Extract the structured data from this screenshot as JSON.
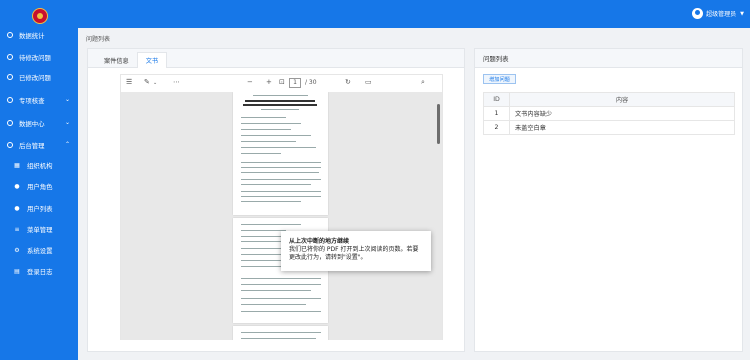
{
  "sidebar": {
    "items": [
      {
        "label": "数据统计",
        "icon": "circle-icon"
      },
      {
        "label": "待修改问题",
        "icon": "circle-icon"
      },
      {
        "label": "已修改问题",
        "icon": "circle-icon"
      },
      {
        "label": "专项核查",
        "icon": "circle-icon"
      },
      {
        "label": "数据中心",
        "icon": "circle-icon"
      },
      {
        "label": "后台管理",
        "icon": "circle-icon"
      }
    ],
    "sub_items": [
      {
        "label": "组织机构",
        "icon": "org-icon"
      },
      {
        "label": "用户角色",
        "icon": "user-icon"
      },
      {
        "label": "用户列表",
        "icon": "user-icon"
      },
      {
        "label": "菜单管理",
        "icon": "menu-icon"
      },
      {
        "label": "系统设置",
        "icon": "gear-icon"
      },
      {
        "label": "登录日志",
        "icon": "log-icon"
      }
    ]
  },
  "header": {
    "user_name": "超级管理员"
  },
  "breadcrumb": "问题列表",
  "left_panel": {
    "tabs": [
      {
        "label": "案件信息"
      },
      {
        "label": "文书"
      }
    ]
  },
  "pdf": {
    "page_current": "1",
    "page_total": "/ 30",
    "tooltip_title": "从上次中断的地方继续",
    "tooltip_body": "我们已将你的 PDF 打开到上次阅读的页数。若要更改此行为，请转到\"设置\"。"
  },
  "right_panel": {
    "title": "问题列表",
    "add_button": "增加问题",
    "columns": [
      "ID",
      "内容"
    ],
    "rows": [
      {
        "id": "1",
        "content": "文书内容缺少"
      },
      {
        "id": "2",
        "content": "未盖空白章"
      }
    ]
  },
  "colors": {
    "primary": "#1677e8",
    "logo": "#c8102e"
  }
}
